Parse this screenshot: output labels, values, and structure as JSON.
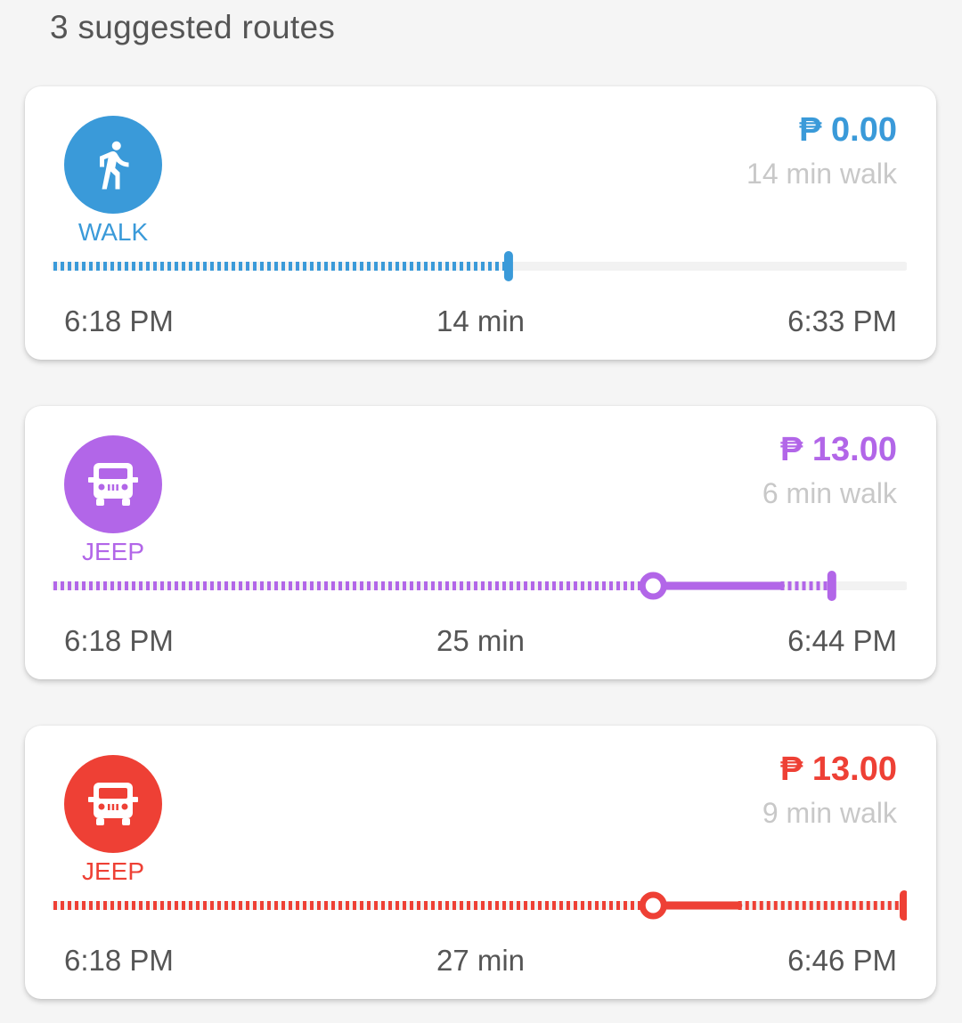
{
  "header": {
    "title": "3 suggested routes"
  },
  "routes": [
    {
      "mode": "WALK",
      "icon": "walk-icon",
      "color": "#3a9ad9",
      "fare": "₱ 0.00",
      "walk": "14 min walk",
      "depart": "6:18 PM",
      "duration": "14 min",
      "arrive": "6:33 PM",
      "segments": [
        {
          "kind": "walk",
          "from": 0.0,
          "to": 0.535
        }
      ],
      "progress_end": 0.535
    },
    {
      "mode": "JEEP",
      "icon": "jeepney-icon",
      "color": "#b266e8",
      "fare": "₱ 13.00",
      "walk": "6 min walk",
      "depart": "6:18 PM",
      "duration": "25 min",
      "arrive": "6:44 PM",
      "segments": [
        {
          "kind": "walk",
          "from": 0.0,
          "to": 0.705
        },
        {
          "kind": "ride",
          "from": 0.705,
          "to": 0.855
        },
        {
          "kind": "walk",
          "from": 0.855,
          "to": 0.915
        }
      ],
      "progress_end": 0.915
    },
    {
      "mode": "JEEP",
      "icon": "jeepney-icon",
      "color": "#ee4035",
      "fare": "₱ 13.00",
      "walk": "9 min walk",
      "depart": "6:18 PM",
      "duration": "27 min",
      "arrive": "6:46 PM",
      "segments": [
        {
          "kind": "walk",
          "from": 0.0,
          "to": 0.705
        },
        {
          "kind": "ride",
          "from": 0.705,
          "to": 0.805
        },
        {
          "kind": "walk",
          "from": 0.805,
          "to": 1.0
        }
      ],
      "progress_end": 1.0
    }
  ]
}
